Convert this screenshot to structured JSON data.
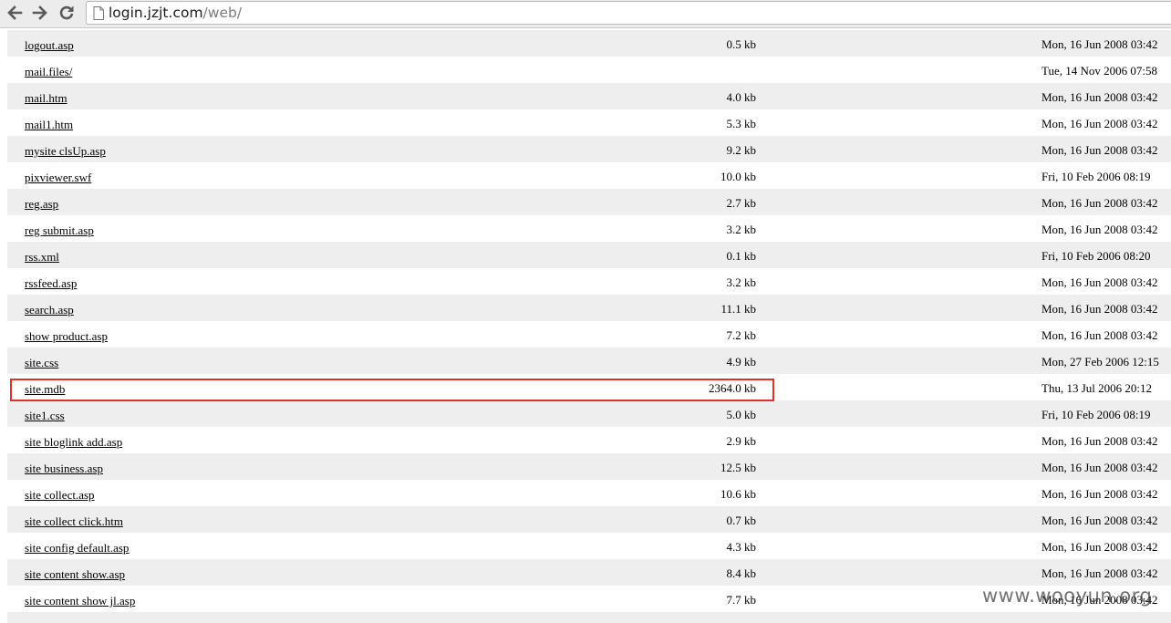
{
  "browser": {
    "url_host": "login.jzjt.com",
    "url_path": "/web/"
  },
  "files": [
    {
      "name": "logout.asp",
      "size": "0.5 kb",
      "date": "Mon, 16 Jun 2008 03:42"
    },
    {
      "name": "mail.files/",
      "size": "",
      "date": "Tue, 14 Nov 2006 07:58"
    },
    {
      "name": "mail.htm",
      "size": "4.0 kb",
      "date": "Mon, 16 Jun 2008 03:42"
    },
    {
      "name": "mail1.htm",
      "size": "5.3 kb",
      "date": "Mon, 16 Jun 2008 03:42"
    },
    {
      "name": "mysite clsUp.asp",
      "size": "9.2 kb",
      "date": "Mon, 16 Jun 2008 03:42"
    },
    {
      "name": "pixviewer.swf",
      "size": "10.0 kb",
      "date": "Fri, 10 Feb 2006 08:19"
    },
    {
      "name": "reg.asp",
      "size": "2.7 kb",
      "date": "Mon, 16 Jun 2008 03:42"
    },
    {
      "name": "reg submit.asp",
      "size": "3.2 kb",
      "date": "Mon, 16 Jun 2008 03:42"
    },
    {
      "name": "rss.xml",
      "size": "0.1 kb",
      "date": "Fri, 10 Feb 2006 08:20"
    },
    {
      "name": "rssfeed.asp",
      "size": "3.2 kb",
      "date": "Mon, 16 Jun 2008 03:42"
    },
    {
      "name": "search.asp",
      "size": "11.1 kb",
      "date": "Mon, 16 Jun 2008 03:42"
    },
    {
      "name": "show product.asp",
      "size": "7.2 kb",
      "date": "Mon, 16 Jun 2008 03:42"
    },
    {
      "name": "site.css",
      "size": "4.9 kb",
      "date": "Mon, 27 Feb 2006 12:15"
    },
    {
      "name": "site.mdb",
      "size": "2364.0 kb",
      "date": "Thu, 13 Jul 2006 20:12",
      "highlighted": true
    },
    {
      "name": "site1.css",
      "size": "5.0 kb",
      "date": "Fri, 10 Feb 2006 08:19"
    },
    {
      "name": "site bloglink add.asp",
      "size": "2.9 kb",
      "date": "Mon, 16 Jun 2008 03:42"
    },
    {
      "name": "site business.asp",
      "size": "12.5 kb",
      "date": "Mon, 16 Jun 2008 03:42"
    },
    {
      "name": "site collect.asp",
      "size": "10.6 kb",
      "date": "Mon, 16 Jun 2008 03:42"
    },
    {
      "name": "site collect click.htm",
      "size": "0.7 kb",
      "date": "Mon, 16 Jun 2008 03:42"
    },
    {
      "name": "site config default.asp",
      "size": "4.3 kb",
      "date": "Mon, 16 Jun 2008 03:42"
    },
    {
      "name": "site content show.asp",
      "size": "8.4 kb",
      "date": "Mon, 16 Jun 2008 03:42"
    },
    {
      "name": "site content show jl.asp",
      "size": "7.7 kb",
      "date": "Mon, 16 Jun 2008 03:42"
    }
  ],
  "watermark": "www.wooyun.org",
  "colors": {
    "highlight_border": "#e0302a",
    "row_alt_background": "#eeeeee"
  }
}
